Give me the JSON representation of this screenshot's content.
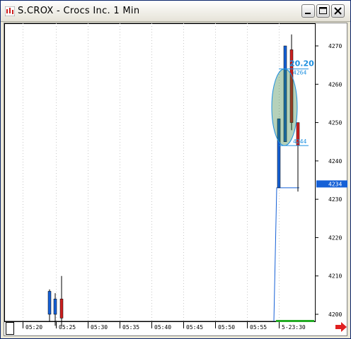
{
  "window": {
    "title": "S.CROX - Crocs Inc. 1 Min"
  },
  "title_buttons": {
    "minimize": "minimize",
    "maximize": "maximize",
    "close": "close"
  },
  "colors": {
    "up": "#1560d6",
    "down": "#cc1f1f",
    "price_tag": "#1560d6",
    "measure": "#1e90e0",
    "green_bar": "#22aa22",
    "grid": "#c8c8c8",
    "arrow": "#e02020"
  },
  "chart_data": {
    "type": "candlestick",
    "title": "",
    "ylim": [
      4196,
      4274
    ],
    "y_ticks": [
      "4270",
      "4260",
      "4250",
      "4240",
      "4230",
      "4220",
      "4210",
      "4200"
    ],
    "x_ticks": [
      "05:20",
      "05:25",
      "05:30",
      "05:35",
      "05:40",
      "05:45",
      "05:50",
      "05:55",
      "5-23:30"
    ],
    "candles": [
      {
        "open": 4200,
        "high": 4206.5,
        "low": 4198,
        "close": 4206,
        "dir": "up"
      },
      {
        "open": 4200,
        "high": 4205.5,
        "low": 4197,
        "close": 4204,
        "dir": "up"
      },
      {
        "open": 4204,
        "high": 4210,
        "low": 4197,
        "close": 4199,
        "dir": "down"
      },
      {
        "open": 4233,
        "high": 4251,
        "low": 4233,
        "close": 4251,
        "dir": "up"
      },
      {
        "open": 4245,
        "high": 4270,
        "low": 4245,
        "close": 4270,
        "dir": "up"
      },
      {
        "open": 4269,
        "high": 4273,
        "low": 4248,
        "close": 4250,
        "dir": "down"
      },
      {
        "open": 4250,
        "high": 4250,
        "low": 4232,
        "close": 4244,
        "dir": "down"
      }
    ],
    "last_price_tag": "4234",
    "measure": {
      "label": "20.20",
      "top_label": "4264",
      "bottom_label": "4244"
    }
  }
}
